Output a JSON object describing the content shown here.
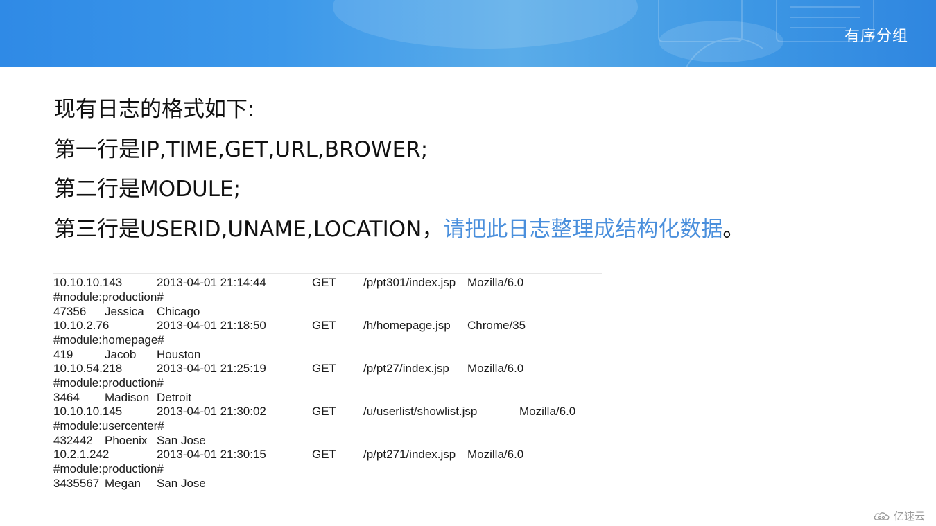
{
  "header": {
    "title": "有序分组"
  },
  "intro": {
    "line1": "现有日志的格式如下:",
    "line2": "第一行是IP,TIME,GET,URL,BROWER;",
    "line3": "第二行是MODULE;",
    "line4_prefix": "第三行是USERID,UNAME,LOCATION，",
    "line4_highlight": "请把此日志整理成结构化数据",
    "line4_suffix": "。"
  },
  "log": [
    {
      "ip": "10.10.10.143",
      "time": "2013-04-01 21:14:44",
      "method": "GET",
      "url": "/p/pt301/index.jsp",
      "browser": "Mozilla/6.0",
      "module": "#module:production#",
      "userid": "47356",
      "uname": "Jessica",
      "location": "Chicago"
    },
    {
      "ip": "10.10.2.76",
      "time": "2013-04-01 21:18:50",
      "method": "GET",
      "url": "/h/homepage.jsp",
      "browser": "Chrome/35",
      "module": "#module:homepage#",
      "userid": "419",
      "uname": "Jacob",
      "location": "Houston"
    },
    {
      "ip": "10.10.54.218",
      "time": "2013-04-01 21:25:19",
      "method": "GET",
      "url": "/p/pt27/index.jsp",
      "browser": "Mozilla/6.0",
      "module": "#module:production#",
      "userid": "3464",
      "uname": "Madison",
      "location": "Detroit"
    },
    {
      "ip": "10.10.10.145",
      "time": "2013-04-01 21:30:02",
      "method": "GET",
      "url": "/u/userlist/showlist.jsp",
      "browser": "Mozilla/6.0",
      "module": "#module:usercenter#",
      "userid": "432442",
      "uname": "Phoenix",
      "location": "San Jose"
    },
    {
      "ip": "10.2.1.242",
      "time": "2013-04-01 21:30:15",
      "method": "GET",
      "url": "/p/pt271/index.jsp",
      "browser": "Mozilla/6.0",
      "module": "#module:production#",
      "userid": "3435567",
      "uname": "Megan",
      "location": "San Jose"
    }
  ],
  "watermark": {
    "brand": "亿速云",
    "icon": "cloud-logo-icon"
  },
  "colors": {
    "banner": "#3c98ea",
    "highlight": "#4a8fdc",
    "text": "#111111"
  }
}
